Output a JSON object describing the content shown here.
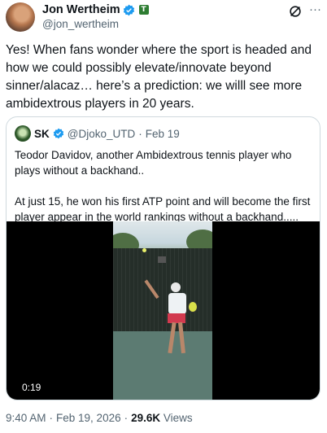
{
  "author": {
    "name": "Jon Wertheim",
    "handle": "@jon_wertheim",
    "affiliation_badge": "T"
  },
  "tweet": {
    "text": "Yes! When fans wonder where the sport is headed and how we could possibly elevate/innovate beyond sinner/alacaz… here’s a prediction: we willl see more ambidextrous players in 20 years."
  },
  "quote": {
    "name": "SK",
    "handle": "@Djoko_UTD",
    "separator": "·",
    "date": "Feb 19",
    "paragraph1": "Teodor Davidov, another Ambidextrous tennis player who plays without a backhand..",
    "paragraph2": "At just 15, he won his first ATP point and will become the first player appear in the world rankings without a backhand.....",
    "video_time": "0:19"
  },
  "footer": {
    "time": "9:40 AM",
    "dot1": "·",
    "date": "Feb 19, 2026",
    "dot2": "·",
    "views_count": "29.6K",
    "views_label": "Views"
  },
  "icons": {
    "verified": "verified-badge-icon",
    "grok": "grok-icon",
    "more": "more-icon"
  },
  "colors": {
    "verified_blue": "#1d9bf0",
    "secondary_text": "#536471",
    "border": "#cfd9de"
  }
}
